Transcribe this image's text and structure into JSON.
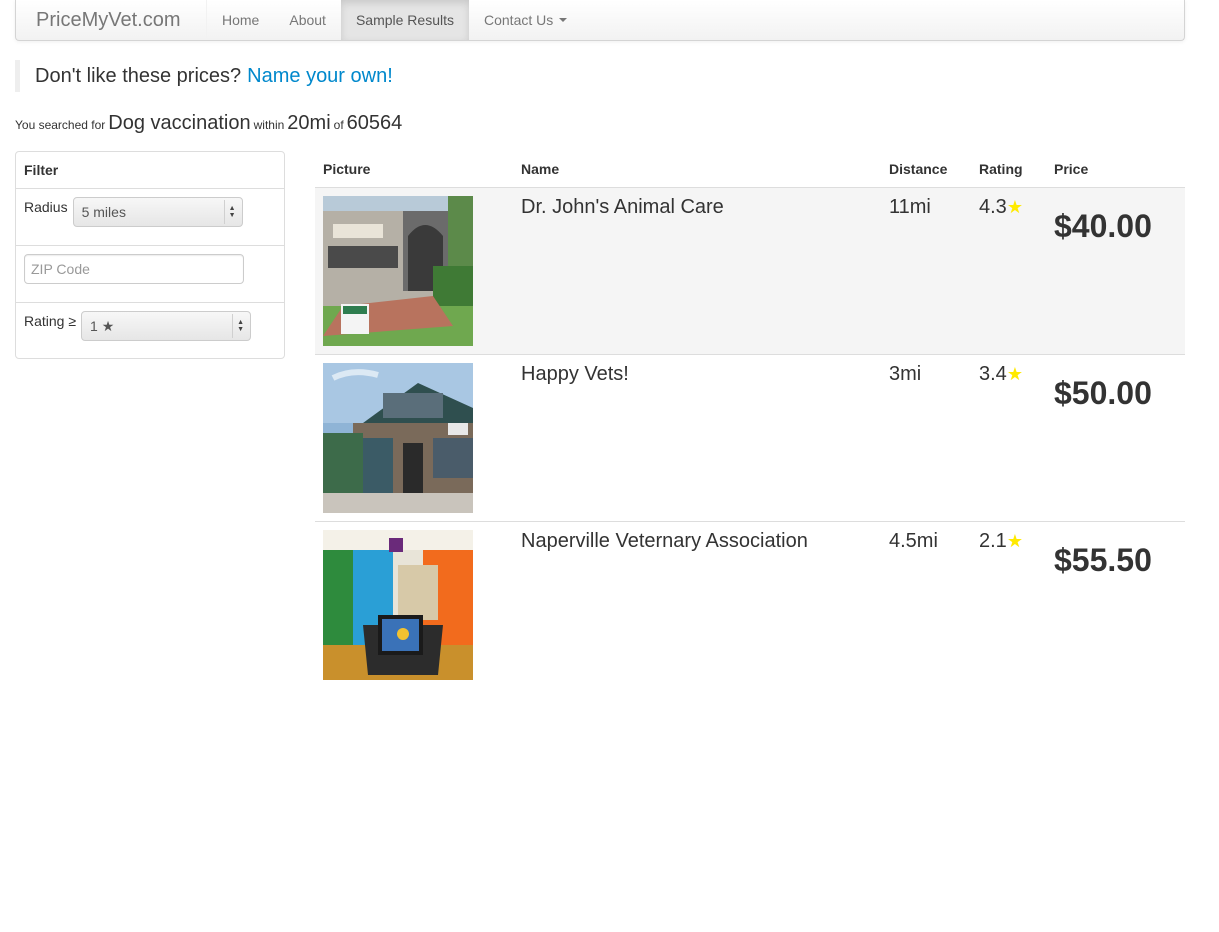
{
  "navbar": {
    "brand": "PriceMyVet.com",
    "items": [
      {
        "label": "Home",
        "active": false
      },
      {
        "label": "About",
        "active": false
      },
      {
        "label": "Sample Results",
        "active": true
      },
      {
        "label": "Contact Us",
        "active": false
      }
    ]
  },
  "callout": {
    "text": "Don't like these prices?",
    "link": "Name your own!"
  },
  "summary": {
    "prefix": "You searched for",
    "query": "Dog vaccination",
    "within_label": "within",
    "radius": "20mi",
    "of_label": "of",
    "zip": "60564"
  },
  "filter": {
    "title": "Filter",
    "radius_label": "Radius",
    "radius_value": "5 miles",
    "zip_placeholder": "ZIP Code",
    "rating_label": "Rating ≥",
    "rating_value": "1 ★"
  },
  "table": {
    "headers": [
      "Picture",
      "Name",
      "Distance",
      "Rating",
      "Price"
    ],
    "rows": [
      {
        "name": "Dr. John's Animal Care",
        "distance": "11mi",
        "rating": "4.3",
        "price": "$40.00"
      },
      {
        "name": "Happy Vets!",
        "distance": "3mi",
        "rating": "3.4",
        "price": "$50.00"
      },
      {
        "name": "Naperville Veternary Association",
        "distance": "4.5mi",
        "rating": "2.1",
        "price": "$55.50"
      }
    ]
  },
  "colors": {
    "link": "#0088cc",
    "star": "#ffea00",
    "stripe": "#f5f5f5"
  }
}
